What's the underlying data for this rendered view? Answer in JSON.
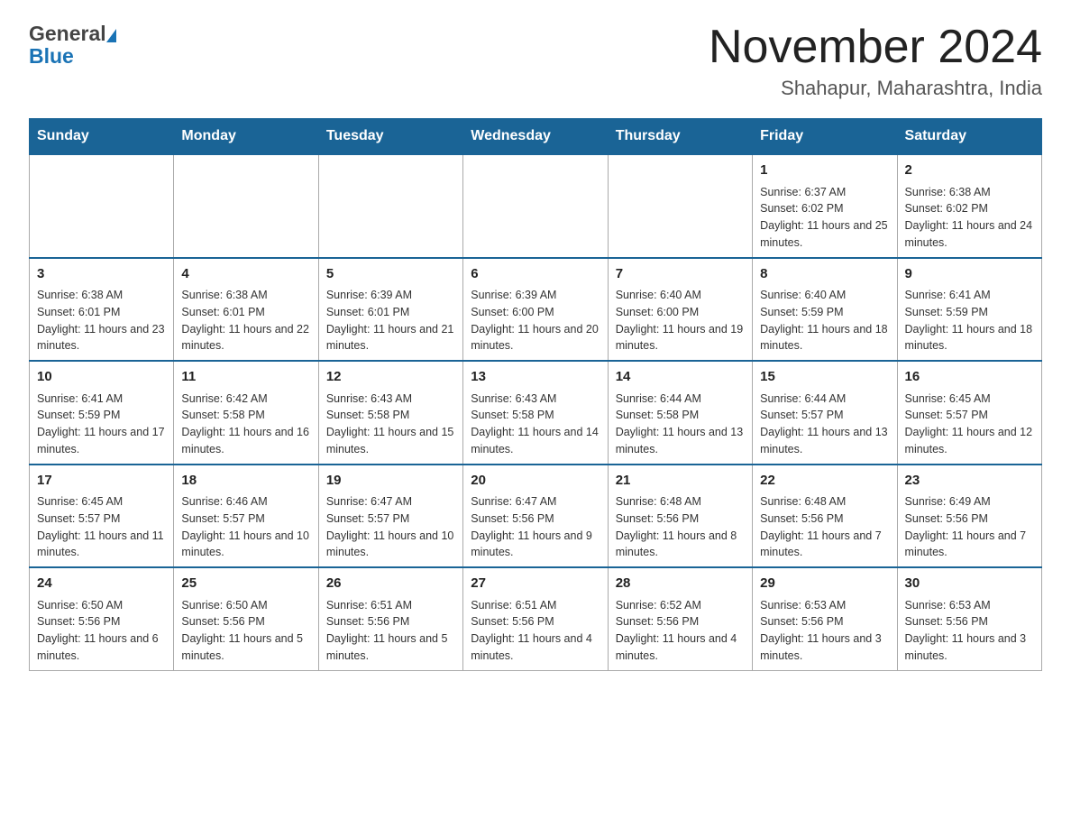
{
  "header": {
    "logo_general": "General",
    "logo_blue": "Blue",
    "main_title": "November 2024",
    "subtitle": "Shahapur, Maharashtra, India"
  },
  "calendar": {
    "days_of_week": [
      "Sunday",
      "Monday",
      "Tuesday",
      "Wednesday",
      "Thursday",
      "Friday",
      "Saturday"
    ],
    "weeks": [
      {
        "days": [
          {
            "num": "",
            "info": "",
            "empty": true
          },
          {
            "num": "",
            "info": "",
            "empty": true
          },
          {
            "num": "",
            "info": "",
            "empty": true
          },
          {
            "num": "",
            "info": "",
            "empty": true
          },
          {
            "num": "",
            "info": "",
            "empty": true
          },
          {
            "num": "1",
            "info": "Sunrise: 6:37 AM\nSunset: 6:02 PM\nDaylight: 11 hours and 25 minutes.",
            "empty": false
          },
          {
            "num": "2",
            "info": "Sunrise: 6:38 AM\nSunset: 6:02 PM\nDaylight: 11 hours and 24 minutes.",
            "empty": false
          }
        ]
      },
      {
        "days": [
          {
            "num": "3",
            "info": "Sunrise: 6:38 AM\nSunset: 6:01 PM\nDaylight: 11 hours and 23 minutes.",
            "empty": false
          },
          {
            "num": "4",
            "info": "Sunrise: 6:38 AM\nSunset: 6:01 PM\nDaylight: 11 hours and 22 minutes.",
            "empty": false
          },
          {
            "num": "5",
            "info": "Sunrise: 6:39 AM\nSunset: 6:01 PM\nDaylight: 11 hours and 21 minutes.",
            "empty": false
          },
          {
            "num": "6",
            "info": "Sunrise: 6:39 AM\nSunset: 6:00 PM\nDaylight: 11 hours and 20 minutes.",
            "empty": false
          },
          {
            "num": "7",
            "info": "Sunrise: 6:40 AM\nSunset: 6:00 PM\nDaylight: 11 hours and 19 minutes.",
            "empty": false
          },
          {
            "num": "8",
            "info": "Sunrise: 6:40 AM\nSunset: 5:59 PM\nDaylight: 11 hours and 18 minutes.",
            "empty": false
          },
          {
            "num": "9",
            "info": "Sunrise: 6:41 AM\nSunset: 5:59 PM\nDaylight: 11 hours and 18 minutes.",
            "empty": false
          }
        ]
      },
      {
        "days": [
          {
            "num": "10",
            "info": "Sunrise: 6:41 AM\nSunset: 5:59 PM\nDaylight: 11 hours and 17 minutes.",
            "empty": false
          },
          {
            "num": "11",
            "info": "Sunrise: 6:42 AM\nSunset: 5:58 PM\nDaylight: 11 hours and 16 minutes.",
            "empty": false
          },
          {
            "num": "12",
            "info": "Sunrise: 6:43 AM\nSunset: 5:58 PM\nDaylight: 11 hours and 15 minutes.",
            "empty": false
          },
          {
            "num": "13",
            "info": "Sunrise: 6:43 AM\nSunset: 5:58 PM\nDaylight: 11 hours and 14 minutes.",
            "empty": false
          },
          {
            "num": "14",
            "info": "Sunrise: 6:44 AM\nSunset: 5:58 PM\nDaylight: 11 hours and 13 minutes.",
            "empty": false
          },
          {
            "num": "15",
            "info": "Sunrise: 6:44 AM\nSunset: 5:57 PM\nDaylight: 11 hours and 13 minutes.",
            "empty": false
          },
          {
            "num": "16",
            "info": "Sunrise: 6:45 AM\nSunset: 5:57 PM\nDaylight: 11 hours and 12 minutes.",
            "empty": false
          }
        ]
      },
      {
        "days": [
          {
            "num": "17",
            "info": "Sunrise: 6:45 AM\nSunset: 5:57 PM\nDaylight: 11 hours and 11 minutes.",
            "empty": false
          },
          {
            "num": "18",
            "info": "Sunrise: 6:46 AM\nSunset: 5:57 PM\nDaylight: 11 hours and 10 minutes.",
            "empty": false
          },
          {
            "num": "19",
            "info": "Sunrise: 6:47 AM\nSunset: 5:57 PM\nDaylight: 11 hours and 10 minutes.",
            "empty": false
          },
          {
            "num": "20",
            "info": "Sunrise: 6:47 AM\nSunset: 5:56 PM\nDaylight: 11 hours and 9 minutes.",
            "empty": false
          },
          {
            "num": "21",
            "info": "Sunrise: 6:48 AM\nSunset: 5:56 PM\nDaylight: 11 hours and 8 minutes.",
            "empty": false
          },
          {
            "num": "22",
            "info": "Sunrise: 6:48 AM\nSunset: 5:56 PM\nDaylight: 11 hours and 7 minutes.",
            "empty": false
          },
          {
            "num": "23",
            "info": "Sunrise: 6:49 AM\nSunset: 5:56 PM\nDaylight: 11 hours and 7 minutes.",
            "empty": false
          }
        ]
      },
      {
        "days": [
          {
            "num": "24",
            "info": "Sunrise: 6:50 AM\nSunset: 5:56 PM\nDaylight: 11 hours and 6 minutes.",
            "empty": false
          },
          {
            "num": "25",
            "info": "Sunrise: 6:50 AM\nSunset: 5:56 PM\nDaylight: 11 hours and 5 minutes.",
            "empty": false
          },
          {
            "num": "26",
            "info": "Sunrise: 6:51 AM\nSunset: 5:56 PM\nDaylight: 11 hours and 5 minutes.",
            "empty": false
          },
          {
            "num": "27",
            "info": "Sunrise: 6:51 AM\nSunset: 5:56 PM\nDaylight: 11 hours and 4 minutes.",
            "empty": false
          },
          {
            "num": "28",
            "info": "Sunrise: 6:52 AM\nSunset: 5:56 PM\nDaylight: 11 hours and 4 minutes.",
            "empty": false
          },
          {
            "num": "29",
            "info": "Sunrise: 6:53 AM\nSunset: 5:56 PM\nDaylight: 11 hours and 3 minutes.",
            "empty": false
          },
          {
            "num": "30",
            "info": "Sunrise: 6:53 AM\nSunset: 5:56 PM\nDaylight: 11 hours and 3 minutes.",
            "empty": false
          }
        ]
      }
    ]
  }
}
